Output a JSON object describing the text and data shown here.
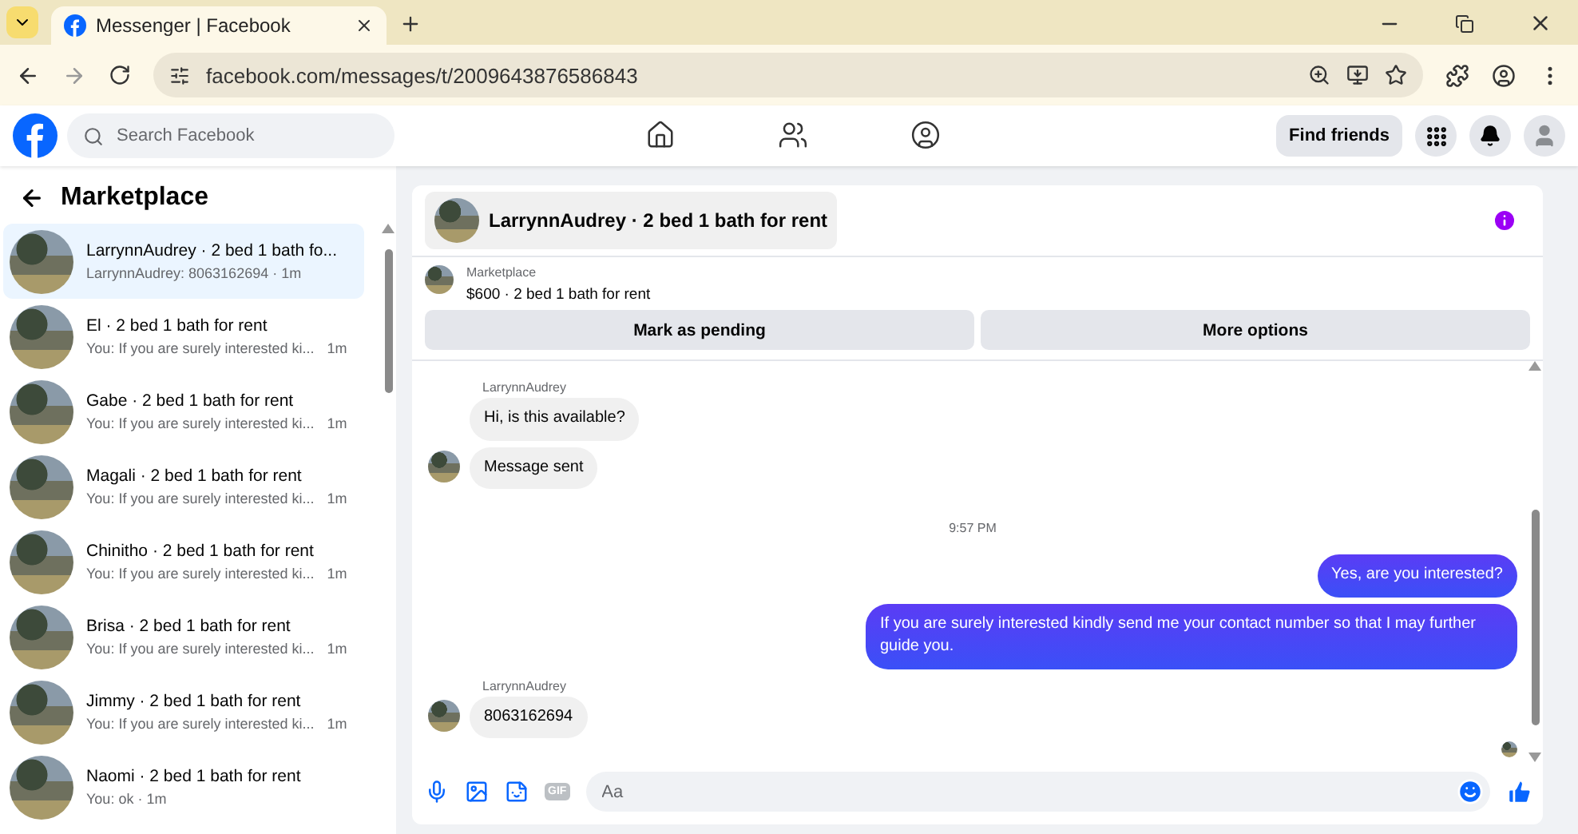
{
  "browser": {
    "tab_title": "Messenger | Facebook",
    "url": "facebook.com/messages/t/2009643876586843"
  },
  "header": {
    "search_placeholder": "Search Facebook",
    "nav": [
      {
        "selected": false
      },
      {
        "selected": false
      },
      {
        "selected": false
      }
    ],
    "find_friends": "Find friends"
  },
  "sidebar": {
    "title": "Marketplace",
    "items": [
      {
        "title": "LarrynnAudrey · 2 bed 1 bath fo...",
        "preview": "LarrynnAudrey: 8063162694 · 1m",
        "selected": true
      },
      {
        "title": "El · 2 bed 1 bath for rent",
        "preview": "You: If you are surely interested ki...",
        "time": "1m",
        "selected": false
      },
      {
        "title": "Gabe · 2 bed 1 bath for rent",
        "preview": "You: If you are surely interested ki...",
        "time": "1m",
        "selected": false
      },
      {
        "title": "Magali · 2 bed 1 bath for rent",
        "preview": "You: If you are surely interested ki...",
        "time": "1m",
        "selected": false
      },
      {
        "title": "Chinitho · 2 bed 1 bath for rent",
        "preview": "You: If you are surely interested ki...",
        "time": "1m",
        "selected": false
      },
      {
        "title": "Brisa · 2 bed 1 bath for rent",
        "preview": "You: If you are surely interested ki...",
        "time": "1m",
        "selected": false
      },
      {
        "title": "Jimmy · 2 bed 1 bath for rent",
        "preview": "You: If you are surely interested ki...",
        "time": "1m",
        "selected": false
      },
      {
        "title": "Naomi · 2 bed 1 bath for rent",
        "preview": "You: ok · 1m",
        "selected": false
      }
    ]
  },
  "chat": {
    "title": "LarrynnAudrey · 2 bed 1 bath for rent",
    "listing": {
      "source": "Marketplace",
      "summary": "$600 · 2 bed 1 bath for rent"
    },
    "actions": [
      "Mark as pending",
      "More options"
    ],
    "messages": [
      {
        "kind": "incoming",
        "sender": "LarrynnAudrey",
        "bubbles": [
          "Hi, is this available?",
          "Message sent"
        ]
      },
      {
        "kind": "time",
        "text": "9:57 PM"
      },
      {
        "kind": "outgoing",
        "bubbles": [
          "Yes, are you interested?",
          "If you are surely interested kindly send me your contact number so that I may further guide you."
        ]
      },
      {
        "kind": "incoming",
        "sender": "LarrynnAudrey",
        "bubbles": [
          "8063162694"
        ]
      }
    ],
    "composer": {
      "placeholder": "Aa",
      "gif_label": "GIF"
    }
  }
}
